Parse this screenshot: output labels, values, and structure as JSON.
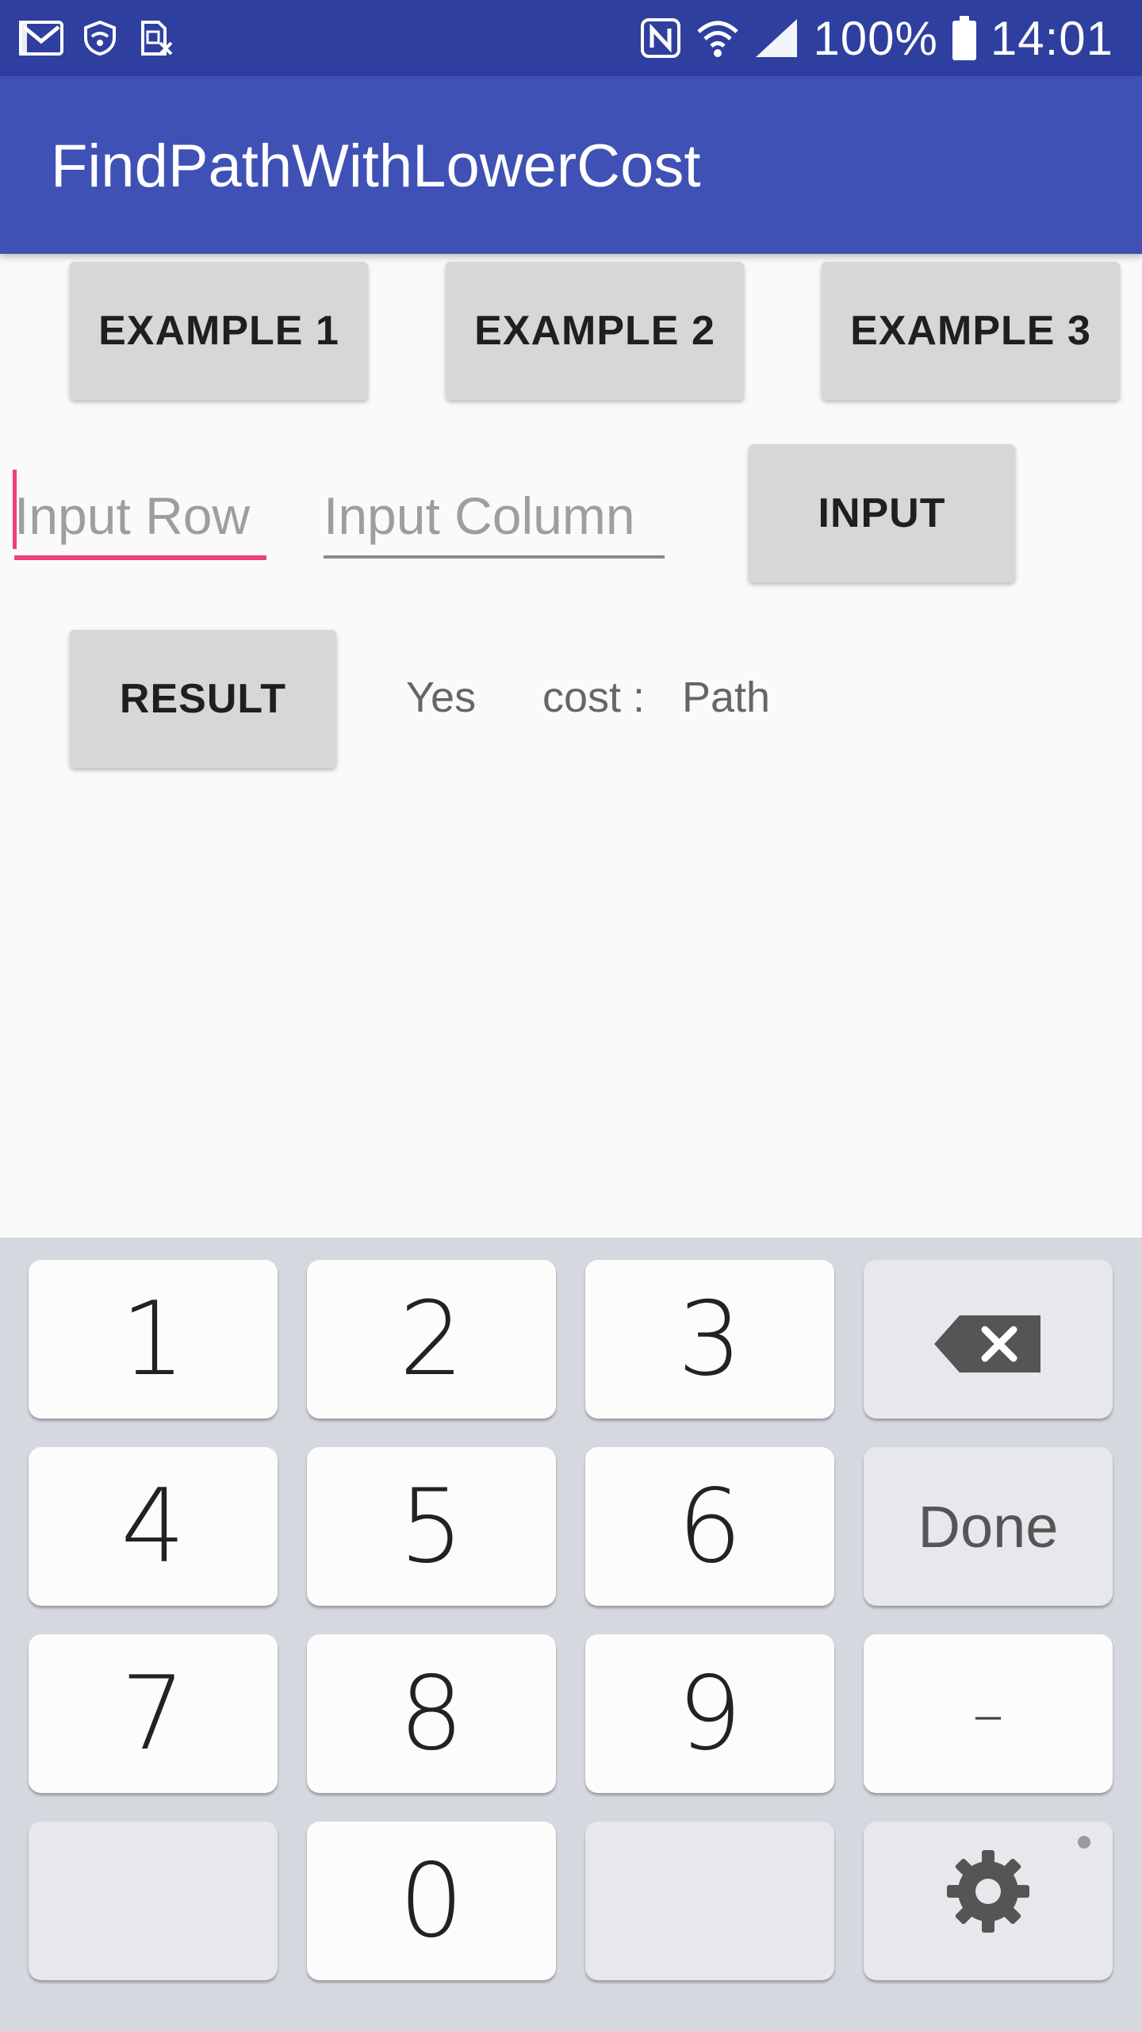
{
  "status_bar": {
    "battery_percent": "100%",
    "time": "14:01",
    "icons_left": [
      "gmail-icon",
      "wifi-shield-icon",
      "sim-off-icon"
    ],
    "icons_right": [
      "nfc-icon",
      "wifi-icon",
      "signal-icon",
      "battery-icon"
    ]
  },
  "app_bar": {
    "title": "FindPathWithLowerCost"
  },
  "buttons": {
    "example1": "EXAMPLE 1",
    "example2": "EXAMPLE 2",
    "example3": "EXAMPLE 3",
    "input": "INPUT",
    "result": "RESULT"
  },
  "fields": {
    "row_placeholder": "Input Row",
    "column_placeholder": "Input Column"
  },
  "output": {
    "yes_text": "Yes",
    "cost_label": "cost :",
    "path_text": "Path"
  },
  "keyboard": {
    "keys": [
      "1",
      "2",
      "3",
      "4",
      "5",
      "6",
      "7",
      "8",
      "9",
      "0"
    ],
    "done": "Done",
    "minus": "–",
    "backspace_icon": "backspace-icon",
    "settings_icon": "gear-icon"
  },
  "colors": {
    "status_bar": "#2f3f9f",
    "app_bar": "#3f51b5",
    "accent": "#ef3f7a"
  }
}
